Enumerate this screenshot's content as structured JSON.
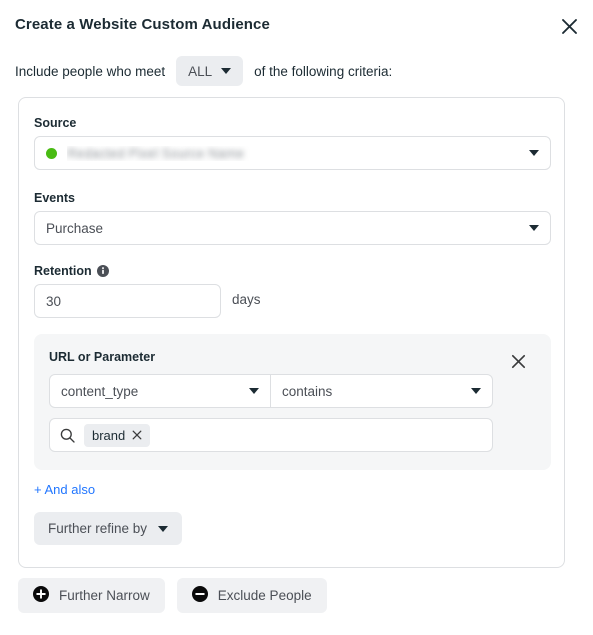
{
  "dialog": {
    "title": "Create a Website Custom Audience",
    "close_icon": "close-icon"
  },
  "criteria": {
    "prefix": "Include people who meet",
    "match_value": "ALL",
    "suffix": "of the following criteria:"
  },
  "source": {
    "label": "Source",
    "value": "Redacted Pixel Source Name",
    "status_color": "#49bb13",
    "redacted": true
  },
  "events": {
    "label": "Events",
    "value": "Purchase"
  },
  "retention": {
    "label": "Retention",
    "info_icon": "info-icon",
    "value": "30",
    "unit": "days"
  },
  "rule": {
    "title": "URL or Parameter",
    "remove_icon": "close-icon",
    "parameter": "content_type",
    "operator": "contains",
    "search_icon": "search-icon",
    "chips": [
      "brand"
    ],
    "chip_remove_icon": "close-icon"
  },
  "actions": {
    "and_also": "+ And also",
    "further_refine": "Further refine by"
  },
  "footer": {
    "further_narrow": "Further Narrow",
    "exclude_people": "Exclude People"
  },
  "colors": {
    "link": "#2176ff",
    "pill_bg": "#ebedf0",
    "panel_bg": "#f5f6f7",
    "border": "#dddfe2",
    "text": "#1c2b33",
    "status_green": "#49bb13"
  }
}
